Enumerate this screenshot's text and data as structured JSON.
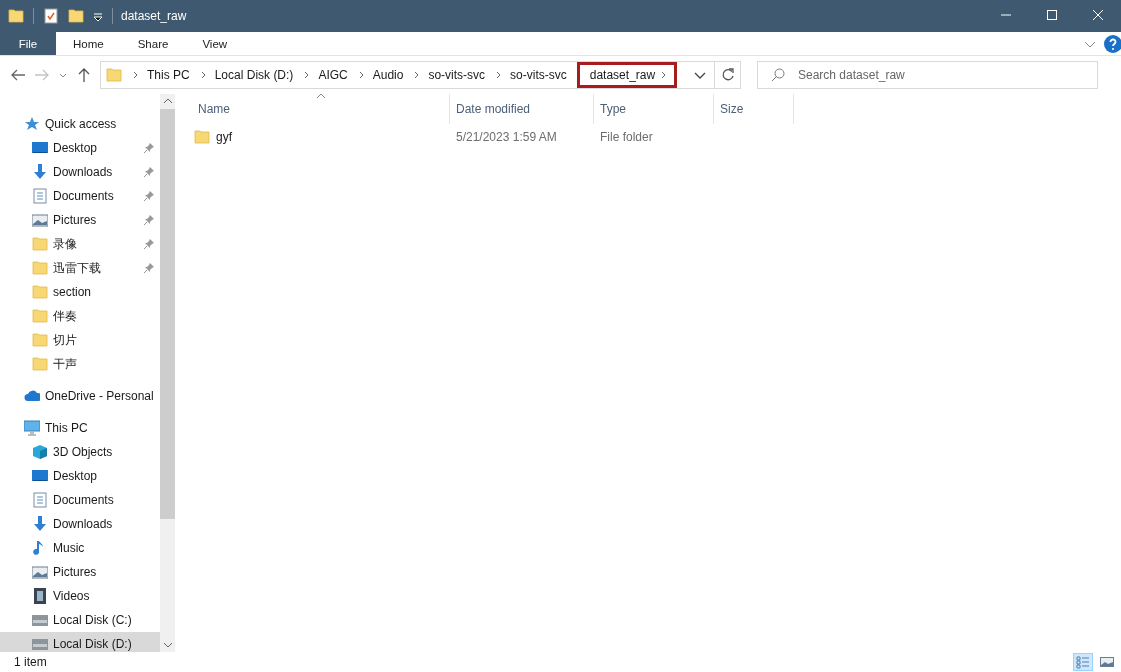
{
  "window": {
    "title": "dataset_raw"
  },
  "ribbon": {
    "tabs": [
      {
        "label": "File",
        "kind": "file",
        "selected": false
      },
      {
        "label": "Home",
        "kind": "tab",
        "selected": false
      },
      {
        "label": "Share",
        "kind": "tab",
        "selected": false
      },
      {
        "label": "View",
        "kind": "tab",
        "selected": false
      }
    ]
  },
  "address_bar": {
    "breadcrumbs": [
      {
        "label": "This PC",
        "highlighted": false
      },
      {
        "label": "Local Disk (D:)",
        "highlighted": false
      },
      {
        "label": "AIGC",
        "highlighted": false
      },
      {
        "label": "Audio",
        "highlighted": false
      },
      {
        "label": "so-vits-svc",
        "highlighted": false
      },
      {
        "label": "so-vits-svc",
        "highlighted": false
      },
      {
        "label": "dataset_raw",
        "highlighted": true
      }
    ]
  },
  "search": {
    "placeholder": "Search dataset_raw"
  },
  "sidebar": {
    "items": [
      {
        "label": "Quick access",
        "kind": "star",
        "selected": false,
        "children": [
          {
            "label": "Desktop",
            "kind": "desktop",
            "pinned": true,
            "selected": false
          },
          {
            "label": "Downloads",
            "kind": "download",
            "pinned": true,
            "selected": false
          },
          {
            "label": "Documents",
            "kind": "document",
            "pinned": true,
            "selected": false
          },
          {
            "label": "Pictures",
            "kind": "picture",
            "pinned": true,
            "selected": false
          },
          {
            "label": "录像",
            "kind": "folder",
            "pinned": true,
            "selected": false
          },
          {
            "label": "迅雷下载",
            "kind": "folder",
            "pinned": true,
            "selected": false
          },
          {
            "label": "section",
            "kind": "folder",
            "pinned": false,
            "selected": false
          },
          {
            "label": "伴奏",
            "kind": "folder",
            "pinned": false,
            "selected": false
          },
          {
            "label": "切片",
            "kind": "folder",
            "pinned": false,
            "selected": false
          },
          {
            "label": "干声",
            "kind": "folder",
            "pinned": false,
            "selected": false
          }
        ]
      },
      {
        "label": "OneDrive - Personal",
        "kind": "cloud",
        "selected": false
      },
      {
        "label": "This PC",
        "kind": "computer",
        "selected": false,
        "children": [
          {
            "label": "3D Objects",
            "kind": "cube",
            "pinned": false,
            "selected": false
          },
          {
            "label": "Desktop",
            "kind": "desktop",
            "pinned": false,
            "selected": false
          },
          {
            "label": "Documents",
            "kind": "document",
            "pinned": false,
            "selected": false
          },
          {
            "label": "Downloads",
            "kind": "download",
            "pinned": false,
            "selected": false
          },
          {
            "label": "Music",
            "kind": "music",
            "pinned": false,
            "selected": false
          },
          {
            "label": "Pictures",
            "kind": "picture",
            "pinned": false,
            "selected": false
          },
          {
            "label": "Videos",
            "kind": "video",
            "pinned": false,
            "selected": false
          },
          {
            "label": "Local Disk (C:)",
            "kind": "drive",
            "pinned": false,
            "selected": false
          },
          {
            "label": "Local Disk (D:)",
            "kind": "drive",
            "pinned": false,
            "selected": true
          }
        ]
      }
    ]
  },
  "table": {
    "columns": [
      "Name",
      "Date modified",
      "Type",
      "Size"
    ],
    "rows": [
      {
        "name": "gyf",
        "date_modified": "5/21/2023 1:59 AM",
        "type": "File folder",
        "size": ""
      }
    ]
  },
  "status_bar": {
    "text": "1 item"
  }
}
